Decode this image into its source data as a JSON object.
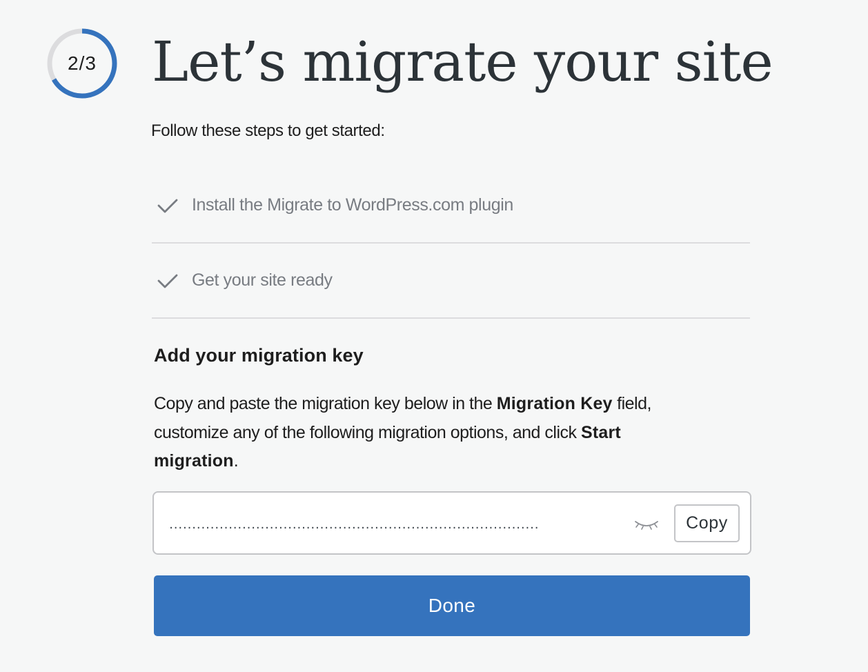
{
  "progress": {
    "label": "2/3",
    "fraction": 0.667,
    "track_color": "#dcdcde",
    "fill_color": "#3573bd"
  },
  "header": {
    "title": "Let’s migrate your site",
    "subtitle": "Follow these steps to get started:"
  },
  "steps": [
    {
      "label": "Install the Migrate to WordPress.com plugin",
      "status": "complete",
      "icon": "check-icon"
    },
    {
      "label": "Get your site ready",
      "status": "complete",
      "icon": "check-icon"
    }
  ],
  "migration_key": {
    "heading": "Add your migration key",
    "instructions": {
      "part1": "Copy and paste the migration key below in the ",
      "bold1": "Migration Key",
      "part2": " field, customize any of the following migration options, and click ",
      "bold2": "Start migration",
      "part3": "."
    },
    "masked_value": "․․․․․․․․․․․․․․․․․․․․․․․․․․․․․․․․․․․․․․․․․․․․․․․․․․․․․․․․․․․․․․․․․․․․․․․․․․․․․․․․․",
    "visibility_icon": "eye-closed-icon",
    "copy_label": "Copy"
  },
  "actions": {
    "done_label": "Done",
    "accent_color": "#3573bd"
  }
}
